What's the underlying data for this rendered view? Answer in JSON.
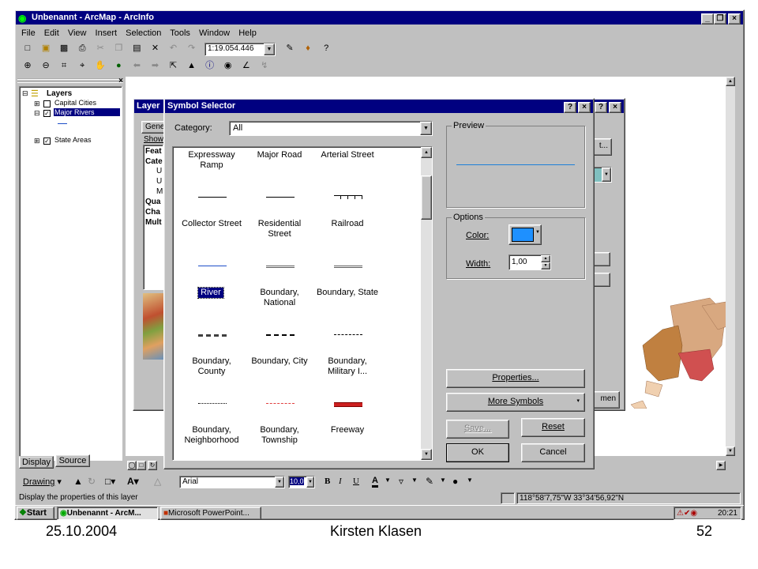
{
  "window": {
    "title": "Unbenannt - ArcMap - ArcInfo"
  },
  "menu": {
    "items": [
      "File",
      "Edit",
      "View",
      "Insert",
      "Selection",
      "Tools",
      "Window",
      "Help"
    ]
  },
  "toolbar": {
    "scale": "1:19.054.446"
  },
  "toc": {
    "layers_label": "Layers",
    "items": [
      "Capital Cities",
      "Major Rivers",
      "State Areas"
    ],
    "tabs": [
      "Display",
      "Source"
    ]
  },
  "layer_props": {
    "title_fragment": "Layer",
    "tab_general": "Gene",
    "show_label": "Show",
    "tree": [
      "Feat",
      "Cate",
      "U",
      "U",
      "M",
      "Qua",
      "Cha",
      "Mult"
    ],
    "right_btn_1": "t...",
    "right_btn_2": "men"
  },
  "symbol_selector": {
    "title": "Symbol Selector",
    "category_label": "Category:",
    "category_value": "All",
    "symbols": [
      {
        "label": "Expressway\nRamp",
        "style": "none",
        "color": "#000000"
      },
      {
        "label": "Major Road",
        "style": "none",
        "color": "#000000"
      },
      {
        "label": "Arterial Street",
        "style": "none",
        "color": "#000000"
      },
      {
        "label": "Collector Street",
        "style": "solid",
        "color": "#000000"
      },
      {
        "label": "Residential\nStreet",
        "style": "solid",
        "color": "#000000"
      },
      {
        "label": "Railroad",
        "style": "railroad",
        "color": "#000000"
      },
      {
        "label": "River",
        "style": "solid",
        "color": "#1e4ec8",
        "selected": true
      },
      {
        "label": "Boundary,\nNational",
        "style": "double-dash",
        "color": "#606060"
      },
      {
        "label": "Boundary, State",
        "style": "double-dash",
        "color": "#606060"
      },
      {
        "label": "Boundary, County",
        "style": "dash-thick",
        "color": "#404040"
      },
      {
        "label": "Boundary, City",
        "style": "dash-dot",
        "color": "#000000"
      },
      {
        "label": "Boundary,\nMilitary I...",
        "style": "dash-dot-light",
        "color": "#000000"
      },
      {
        "label": "Boundary,\nNeighborhood",
        "style": "dash-fine",
        "color": "#000000"
      },
      {
        "label": "Boundary,\nTownship",
        "style": "dash-red",
        "color": "#e04040"
      },
      {
        "label": "Freeway",
        "style": "freeway",
        "color": "#cc2020"
      }
    ],
    "preview_label": "Preview",
    "preview_color": "#1e7fd8",
    "options_label": "Options",
    "color_label": "Color:",
    "color_value": "#1e90ff",
    "width_label": "Width:",
    "width_value": "1,00",
    "buttons": {
      "properties": "Properties...",
      "more_symbols": "More Symbols",
      "save": "Save...",
      "reset": "Reset",
      "ok": "OK",
      "cancel": "Cancel"
    }
  },
  "drawing_toolbar": {
    "drawing_label": "Drawing",
    "font": "Arial",
    "font_size": "10,0"
  },
  "status": {
    "text": "Display the properties of this layer",
    "coords": "118°58'7,75\"W  33°34'56,92\"N"
  },
  "taskbar": {
    "start": "Start",
    "tasks": [
      "Unbenannt - ArcM...",
      "Microsoft PowerPoint..."
    ],
    "clock": "20:21"
  },
  "footer": {
    "date": "25.10.2004",
    "author": "Kirsten Klasen",
    "page": "52"
  }
}
